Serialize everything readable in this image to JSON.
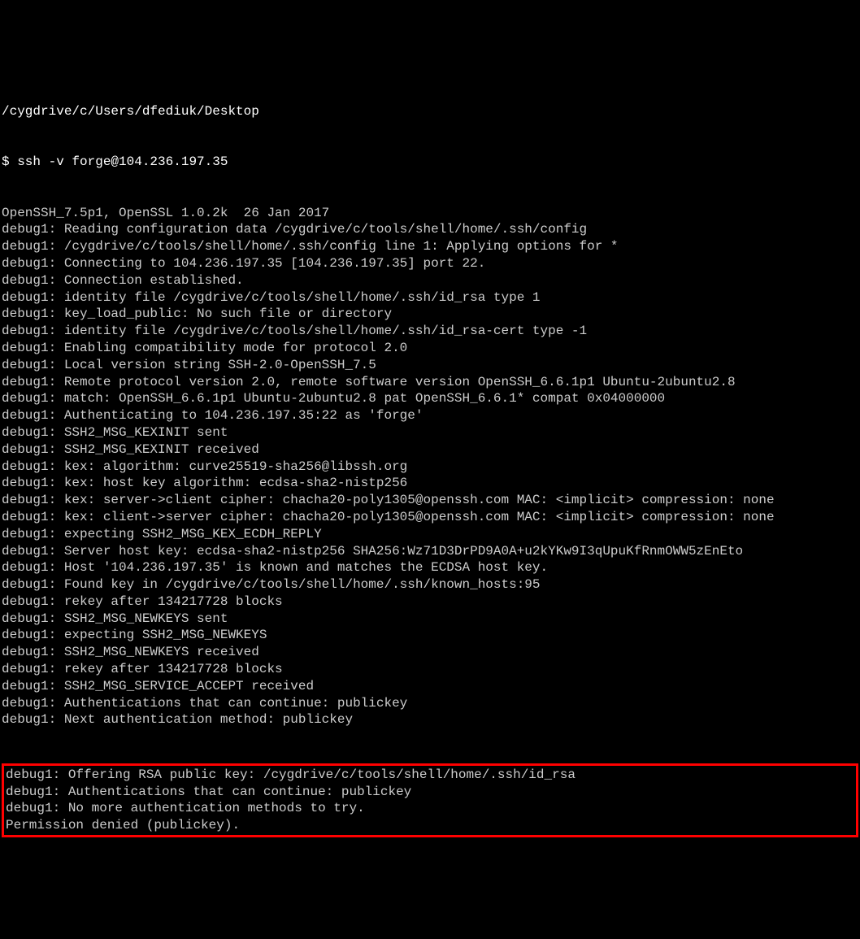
{
  "terminal": {
    "cwd": "/cygdrive/c/Users/dfediuk/Desktop",
    "prompt": "$ ssh -v forge@104.236.197.35",
    "lines": [
      "OpenSSH_7.5p1, OpenSSL 1.0.2k  26 Jan 2017",
      "debug1: Reading configuration data /cygdrive/c/tools/shell/home/.ssh/config",
      "debug1: /cygdrive/c/tools/shell/home/.ssh/config line 1: Applying options for *",
      "debug1: Connecting to 104.236.197.35 [104.236.197.35] port 22.",
      "debug1: Connection established.",
      "debug1: identity file /cygdrive/c/tools/shell/home/.ssh/id_rsa type 1",
      "debug1: key_load_public: No such file or directory",
      "debug1: identity file /cygdrive/c/tools/shell/home/.ssh/id_rsa-cert type -1",
      "debug1: Enabling compatibility mode for protocol 2.0",
      "debug1: Local version string SSH-2.0-OpenSSH_7.5",
      "debug1: Remote protocol version 2.0, remote software version OpenSSH_6.6.1p1 Ubuntu-2ubuntu2.8",
      "debug1: match: OpenSSH_6.6.1p1 Ubuntu-2ubuntu2.8 pat OpenSSH_6.6.1* compat 0x04000000",
      "debug1: Authenticating to 104.236.197.35:22 as 'forge'",
      "debug1: SSH2_MSG_KEXINIT sent",
      "debug1: SSH2_MSG_KEXINIT received",
      "debug1: kex: algorithm: curve25519-sha256@libssh.org",
      "debug1: kex: host key algorithm: ecdsa-sha2-nistp256",
      "debug1: kex: server->client cipher: chacha20-poly1305@openssh.com MAC: <implicit> compression: none",
      "debug1: kex: client->server cipher: chacha20-poly1305@openssh.com MAC: <implicit> compression: none",
      "debug1: expecting SSH2_MSG_KEX_ECDH_REPLY",
      "debug1: Server host key: ecdsa-sha2-nistp256 SHA256:Wz71D3DrPD9A0A+u2kYKw9I3qUpuKfRnmOWW5zEnEto",
      "debug1: Host '104.236.197.35' is known and matches the ECDSA host key.",
      "debug1: Found key in /cygdrive/c/tools/shell/home/.ssh/known_hosts:95",
      "debug1: rekey after 134217728 blocks",
      "debug1: SSH2_MSG_NEWKEYS sent",
      "debug1: expecting SSH2_MSG_NEWKEYS",
      "debug1: SSH2_MSG_NEWKEYS received",
      "debug1: rekey after 134217728 blocks",
      "debug1: SSH2_MSG_SERVICE_ACCEPT received",
      "debug1: Authentications that can continue: publickey",
      "debug1: Next authentication method: publickey"
    ],
    "highlighted_lines": [
      "debug1: Offering RSA public key: /cygdrive/c/tools/shell/home/.ssh/id_rsa",
      "debug1: Authentications that can continue: publickey",
      "debug1: No more authentication methods to try.",
      "Permission denied (publickey)."
    ]
  }
}
